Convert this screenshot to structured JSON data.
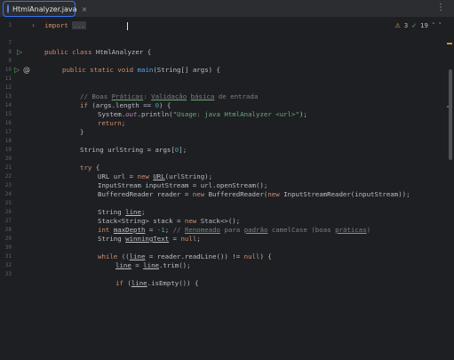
{
  "tab": {
    "file_name": "HtmlAnalyzer.java",
    "close": "×"
  },
  "menu_icon": "⋮",
  "inspections": {
    "warnings": "3",
    "checks": "19",
    "up": "˄",
    "down": "˅"
  },
  "gutter": {
    "line_numbers": [
      "1",
      "7",
      "8",
      "9",
      "10",
      "11",
      "12",
      "13",
      "14",
      "15",
      "16",
      "17",
      "18",
      "19",
      "20",
      "21",
      "22",
      "23",
      "24",
      "25",
      "26",
      "27",
      "28",
      "29",
      "30",
      "31",
      "32",
      "33"
    ],
    "fold_arrow": "›",
    "run_icon": "▷",
    "override_icon": "@"
  },
  "code": {
    "l1_kw": "import",
    "l1_fold": "...",
    "l8_kw": "public class",
    "l8_rest": " HtmlAnalyzer {",
    "l10_kw": "public static void",
    "l10_fn": "main",
    "l10_rest": "(String[] args) {",
    "l12_cm1": "// Boas ",
    "l12_cm2": "Práticas",
    "l12_cm3": ": ",
    "l12_cm4": "Validação",
    "l12_cm5": " ",
    "l12_cm6": "básica",
    "l12_cm7": " de entrada",
    "l13_kw": "if",
    "l13_a": " (args.length == ",
    "l13_num": "0",
    "l13_b": ") {",
    "l14_a": "System.",
    "l14_b": "out",
    "l14_c": ".println(",
    "l14_str": "\"Usage: java HtmlAnalyzer <url>\"",
    "l14_d": ");",
    "l15_kw": "return",
    "l15_rest": ";",
    "l16": "}",
    "l18_a": "String urlString = args[",
    "l18_num": "0",
    "l18_b": "];",
    "l20_kw": "try",
    "l20_rest": " {",
    "l21_a": "URL url = ",
    "l21_kw": "new",
    "l21_b": "URL",
    "l21_c": "(urlString);",
    "l22": "InputStream inputStream = url.openStream();",
    "l23_a": "BufferedReader reader = ",
    "l23_kw1": "new",
    "l23_b": " BufferedReader(",
    "l23_kw2": "new",
    "l23_c": " InputStreamReader(inputStream));",
    "l25_a": "String ",
    "l25_b": "line",
    "l25_c": ";",
    "l26_a": "Stack<String> stack = ",
    "l26_kw": "new",
    "l26_b": " Stack<>();",
    "l27_kw": "int",
    "l27_a": " ",
    "l27_var": "maxDepth",
    "l27_b": " = ",
    "l27_num": "-1",
    "l27_c": "; ",
    "l27_cm1": "// ",
    "l27_cm2": "Renomeado",
    "l27_cm3": " para ",
    "l27_cm4": "padrão",
    "l27_cm5": " camelCase (boas ",
    "l27_cm6": "práticas",
    "l27_cm7": ")",
    "l28_a": "String ",
    "l28_var": "winningText",
    "l28_b": " = ",
    "l28_kw": "null",
    "l28_c": ";",
    "l30_kw1": "while",
    "l30_a": " ((",
    "l30_var": "line",
    "l30_b": " = reader.readLine()) != ",
    "l30_kw2": "null",
    "l30_c": ") {",
    "l31_var1": "line",
    "l31_a": " = ",
    "l31_var2": "line",
    "l31_b": ".trim();",
    "l33_kw": "if",
    "l33_a": " (",
    "l33_var": "line",
    "l33_b": ".isEmpty()) {"
  }
}
